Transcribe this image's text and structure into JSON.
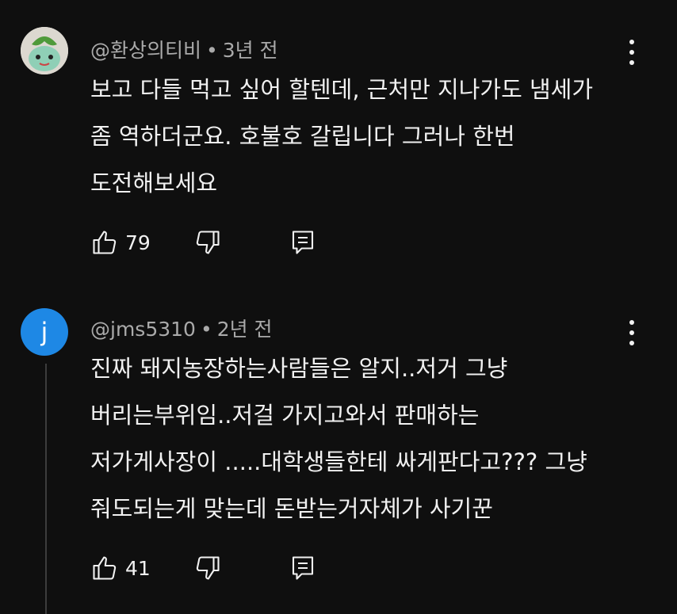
{
  "comments": [
    {
      "author": "@환상의티비",
      "time": "3년 전",
      "lines": [
        "보고 다들 먹고 싶어 할텐데,  근처만 지나가도 냄세가",
        "좀 역하더군요. 호불호 갈립니다 그러나 한번",
        "도전해보세요"
      ],
      "likes": "79"
    },
    {
      "author": "@jms5310",
      "avatar_letter": "j",
      "time": "2년 전",
      "lines": [
        "진짜 돼지농장하는사람들은 알지..저거 그냥",
        "버리는부위임..저걸 가지고와서 판매하는",
        "저가게사장이 .....대학생들한테 싸게판다고???  그냥",
        "줘도되는게 맞는데 돈받는거자체가 사기꾼"
      ],
      "likes": "41"
    }
  ],
  "meta_separator": "•",
  "icons": {
    "like": "thumbs-up-icon",
    "dislike": "thumbs-down-icon",
    "reply": "comment-reply-icon",
    "more": "more-vert-icon"
  },
  "colors": {
    "background": "#0f0f0f",
    "text": "#f1f1f1",
    "meta": "#aaaaaa",
    "avatar_j": "#1e88e5"
  }
}
